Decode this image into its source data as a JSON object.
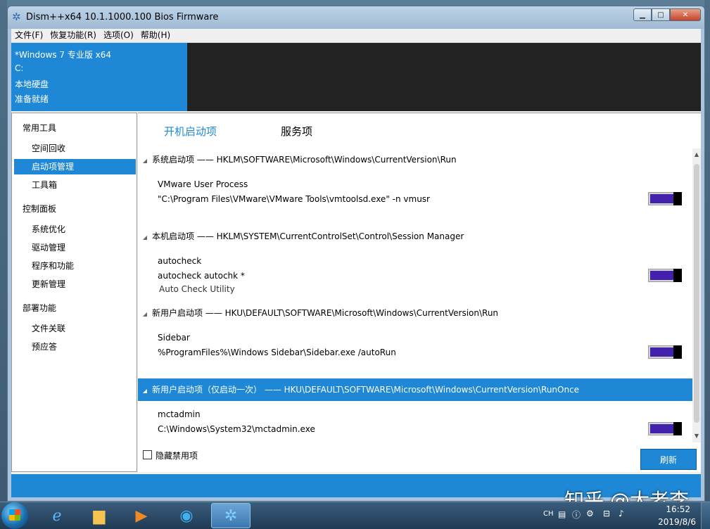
{
  "window": {
    "title": "Dism++x64 10.1.1000.100 Bios Firmware",
    "app_icon": "gear-icon",
    "controls": [
      "minimize",
      "maximize",
      "close"
    ]
  },
  "menu": [
    "文件(F)",
    "恢复功能(R)",
    "选项(O)",
    "帮助(H)"
  ],
  "info": {
    "os": "*Windows 7 专业版 x64",
    "drive": "C:",
    "disk": "本地硬盘",
    "status": "准备就绪"
  },
  "sidebar": {
    "groups": [
      {
        "label": "常用工具",
        "items": [
          "空间回收",
          "启动项管理",
          "工具箱"
        ]
      },
      {
        "label": "控制面板",
        "items": [
          "系统优化",
          "驱动管理",
          "程序和功能",
          "更新管理"
        ]
      },
      {
        "label": "部署功能",
        "items": [
          "文件关联",
          "预应答"
        ]
      }
    ],
    "selected": "启动项管理"
  },
  "tabs": [
    "开机启动项",
    "服务项"
  ],
  "sections": [
    {
      "header": "系统启动项 —— HKLM\\SOFTWARE\\Microsoft\\Windows\\CurrentVersion\\Run",
      "entries": [
        {
          "name": "VMware User Process",
          "command": "\"C:\\Program Files\\VMware\\VMware Tools\\vmtoolsd.exe\" -n vmusr",
          "description": "",
          "enabled": true
        }
      ]
    },
    {
      "header": "本机启动项 —— HKLM\\SYSTEM\\CurrentControlSet\\Control\\Session Manager",
      "entries": [
        {
          "name": "autocheck",
          "command": "autocheck autochk *",
          "description": "Auto Check Utility",
          "enabled": true
        }
      ]
    },
    {
      "header": "新用户启动项 —— HKU\\DEFAULT\\SOFTWARE\\Microsoft\\Windows\\CurrentVersion\\Run",
      "entries": [
        {
          "name": "Sidebar",
          "command": "%ProgramFiles%\\Windows Sidebar\\Sidebar.exe /autoRun",
          "description": "",
          "enabled": true
        }
      ]
    },
    {
      "header": "新用户启动项（仅启动一次） —— HKU\\DEFAULT\\SOFTWARE\\Microsoft\\Windows\\CurrentVersion\\RunOnce",
      "highlighted": true,
      "entries": [
        {
          "name": "mctadmin",
          "command": "C:\\Windows\\System32\\mctadmin.exe",
          "description": "",
          "enabled": true
        }
      ]
    }
  ],
  "footer": {
    "hide_disabled_label": "隐藏禁用项",
    "hide_disabled_checked": false,
    "refresh_label": "刷新"
  },
  "taskbar": {
    "apps": [
      "internet-explorer-icon",
      "folder-icon",
      "media-player-icon",
      "browser-icon",
      "dism-gear-icon"
    ],
    "active_app": "dism-gear-icon",
    "language": "CH",
    "clock_time": "16:52",
    "clock_date": "2019/8/6"
  },
  "watermark": "知乎 @大老李",
  "colors": {
    "accent": "#1e88d6",
    "toggle_on": "#4421ac",
    "dark_panel": "#222222"
  }
}
